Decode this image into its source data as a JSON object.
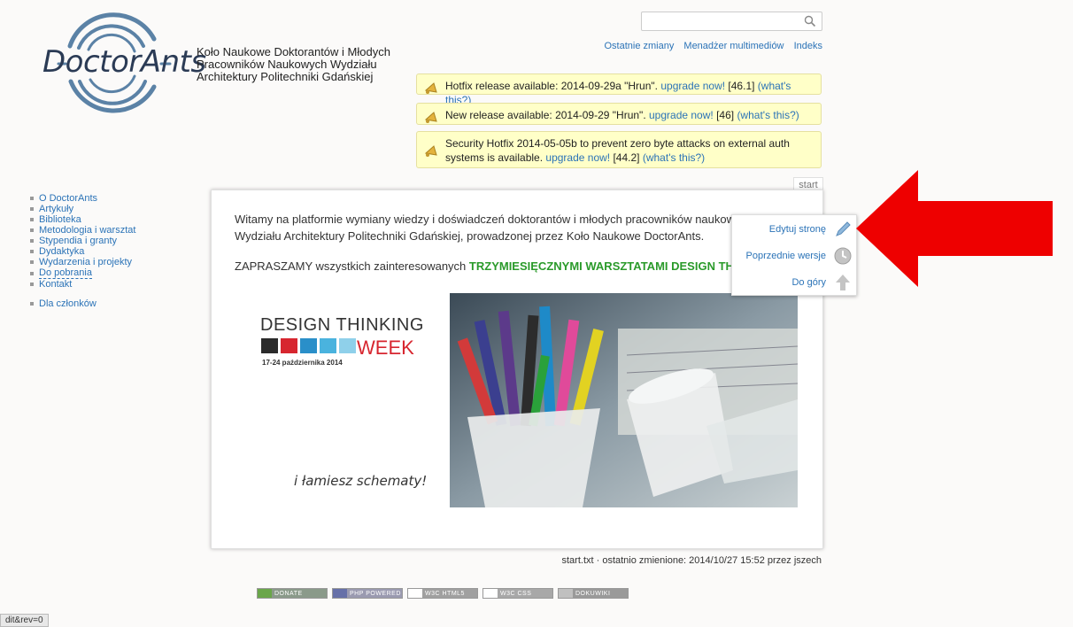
{
  "logo": {
    "text": "DoctorAnts"
  },
  "site_title": "Koło Naukowe Doktorantów i Młodych Pracowników Naukowych Wydziału Architektury Politechniki Gdańskiej",
  "search": {
    "placeholder": "",
    "value": ""
  },
  "top_links": [
    "Ostatnie zmiany",
    "Menadżer multimediów",
    "Indeks"
  ],
  "notices": [
    {
      "text": "Hotfix release available: 2014-09-29a \"Hrun\".",
      "link": "upgrade now!",
      "version": "[46.1]",
      "help": "(what's this?)"
    },
    {
      "text": "New release available: 2014-09-29 \"Hrun\".",
      "link": "upgrade now!",
      "version": "[46]",
      "help": "(what's this?)"
    },
    {
      "text": "Security Hotfix 2014-05-05b to prevent zero byte attacks on external auth systems is available.",
      "link": "upgrade now!",
      "version": "[44.2]",
      "help": "(what's this?)"
    }
  ],
  "sidebar": {
    "items": [
      "O DoctorAnts",
      "Artykuły",
      "Biblioteka",
      "Metodologia i warsztat",
      "Stypendia i granty",
      "Dydaktyka",
      "Wydarzenia i projekty",
      "Do pobrania",
      "Kontakt"
    ],
    "members": "Dla członków"
  },
  "page_id": "start",
  "content": {
    "intro": "Witamy na platformie wymiany wiedzy i doświadczeń doktorantów i młodych pracowników naukowych Wydziału Architektury Politechniki Gdańskiej, prowadzonej przez Koło Naukowe DoctorAnts.",
    "invite_prefix": "ZAPRASZAMY wszystkich zainteresowanych",
    "invite_bold": "TRZYMIESIĘCZNYMI WARSZTATAMI DESIGN THINKING"
  },
  "dt_logo": {
    "title": "DESIGN THINKING",
    "week": "WEEK",
    "date": "17-24 października 2014",
    "slogan": "i łamiesz schematy!",
    "colors": [
      "#2b2b2b",
      "#d7262f",
      "#2a8fc9",
      "#4ab3de",
      "#8fd0ea"
    ]
  },
  "tools": {
    "edit": "Edytuj stronę",
    "revisions": "Poprzednie wersje",
    "top": "Do góry"
  },
  "footer_info": "start.txt · ostatnio zmienione: 2014/10/27 15:52 przez jszech",
  "badges": [
    "DONATE",
    "PHP POWERED",
    "W3C HTML5",
    "W3C CSS",
    "DOKUWIKI"
  ],
  "status_bar": "dit&rev=0",
  "colors": {
    "link": "#2b73b7",
    "notice_bg": "#ffffc8",
    "invite_green": "#2a9a2a",
    "arrow": "#ee0000"
  }
}
